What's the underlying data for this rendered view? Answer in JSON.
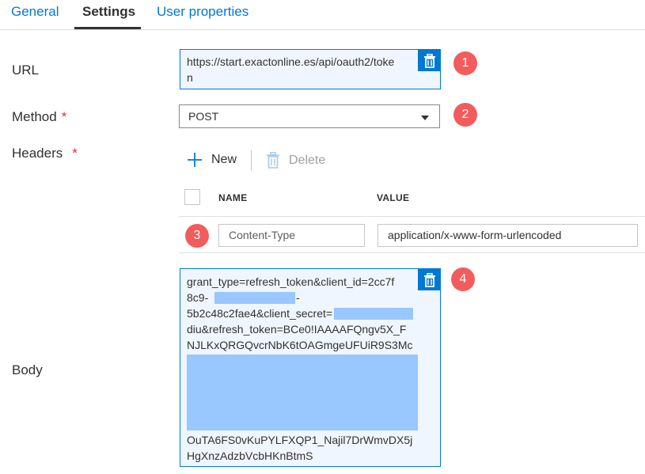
{
  "tabs": [
    {
      "label": "General"
    },
    {
      "label": "Settings"
    },
    {
      "label": "User properties"
    }
  ],
  "url": {
    "label": "URL",
    "value_line1": "https://start.exactonline.es/api/oauth2/toke",
    "value_line2": "n"
  },
  "method": {
    "label": "Method",
    "required_mark": "*",
    "selected": "POST"
  },
  "headers": {
    "label": "Headers",
    "required_mark": "*",
    "new_label": "New",
    "delete_label": "Delete",
    "columns": [
      "NAME",
      "VALUE"
    ],
    "rows": [
      {
        "name_placeholder": "Content-Type",
        "value": "application/x-www-form-urlencoded"
      }
    ]
  },
  "body": {
    "label": "Body",
    "lines": [
      "grant_type=refresh_token&client_id=2cc7f",
      "8c9-",
      "-",
      "5b2c48c2fae4&client_secret=",
      "diu&refresh_token=BCe0!IAAAAFQngv5X_F",
      "NJLKxQRGQvcrNbK6tOAGmgeUFUiR9S3Mc",
      "OuTA6FS0vKuPYLFXQP1_Najil7DrWmvDX5j",
      "HgXnzAdzbVcbHKnBtmS"
    ]
  },
  "badges": [
    "1",
    "2",
    "3",
    "4"
  ],
  "colors": {
    "accent": "#0078d4",
    "badge": "#f25c5c",
    "redaction": "#99c7ff",
    "required": "#d13438"
  }
}
